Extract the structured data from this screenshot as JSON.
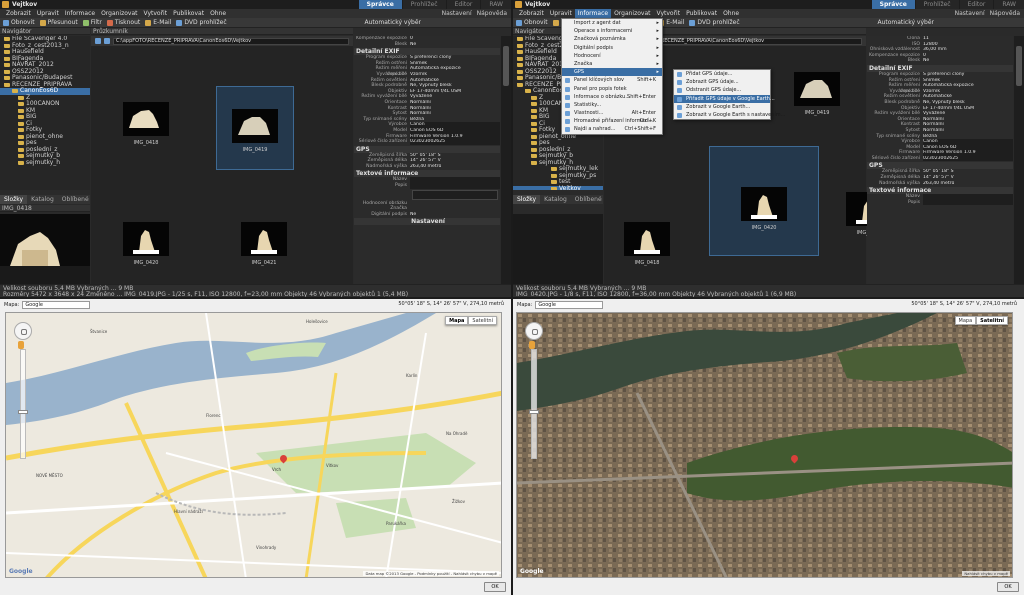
{
  "app": {
    "title": "Vejtkov",
    "modes": [
      "Správce",
      "Prohlížeč",
      "Editor",
      "RAW"
    ],
    "menu": [
      "Zobrazit",
      "Upravit",
      "Informace",
      "Organizovat",
      "Vytvořit",
      "Publikovat",
      "Ohne"
    ],
    "menu_right": [
      "Nastavení",
      "Nápověda"
    ],
    "toolbar": [
      "Obnovit",
      "Přesunout",
      "Filtr",
      "Tisknout",
      "E-Mail",
      "DVD prohlížeč"
    ],
    "toolbar_right": "Automatický výběr"
  },
  "left": {
    "panel_head_tree": "Navigátor",
    "panel_head_browser": "Průzkumník",
    "path": "C:\\appFOTO\\RECENZE_PRIPRAVA\\CanonEos6D\\Vejtkov",
    "tree": [
      "File Scavenger 4.0",
      "Foto_z_cest2013_n",
      "Hausefield",
      "BIFagenda",
      "NÁVRAT_2012",
      "OSSZ2012",
      "Panasonic/Budapest",
      "RECENZE_PRIPRAVA",
      "CanonEos6D",
      "Z",
      "100CANON",
      "KM",
      "BIG",
      "Ci",
      "Fotky",
      "pienot_ohne",
      "pes",
      "poslední_z",
      "sejmutky_b",
      "sejmutky_h"
    ],
    "selected_tree": 8,
    "tabs": [
      "Složky",
      "Katalog",
      "Oblíbené"
    ],
    "preview_head": "IMG_0418",
    "thumbs": [
      "IMG_0418",
      "IMG_0419",
      "IMG_0420",
      "IMG_0421"
    ],
    "status_line1": "Velikost souboru 5,4 MB   Vybraných ... 9 MB",
    "status_line2": "Rozměry 5472 x 3648 x 24   Změněno ...   IMG_0419.JPG - 1/25 s, F11, ISO 12800, f=23,00 mm   Objekty 46   Vybraných objektů 1 (5,4 MB)"
  },
  "info": {
    "rows_top": [
      [
        "Kompenzace expozice",
        "0"
      ],
      [
        "Blesk",
        "Ne"
      ]
    ],
    "exif_title": "Detailní EXIF",
    "exif": [
      [
        "Program expozice",
        "S preferencí clony"
      ],
      [
        "Režim ostření",
        "Snímek"
      ],
      [
        "Režim měření expozice",
        "Automatická expozice"
      ],
      [
        "Vyvážení bílé",
        "Vzorník"
      ],
      [
        "Režim osvětlení",
        "Automatické"
      ],
      [
        "Blesk podrobně",
        "Ne, Vypnutý blesk"
      ],
      [
        "Objektiv",
        "EF 17-40mm f/4L USM"
      ],
      [
        "Režim vyvážení bílé",
        "Vyvážené"
      ],
      [
        "Orientace",
        "Normální"
      ],
      [
        "Kontrast",
        "Normální"
      ],
      [
        "Sytost",
        "Normální"
      ],
      [
        "Typ snímané scény",
        "Běžná"
      ],
      [
        "Výrobce",
        "Canon"
      ],
      [
        "Model",
        "Canon EOS 6D"
      ],
      [
        "Firmware",
        "Firmware Version 1.0.9"
      ],
      [
        "Sériové číslo zařízení",
        "023023002625"
      ]
    ],
    "gps_title": "GPS",
    "gps": [
      [
        "Zeměpisná šířka",
        "50° 05' 18\" S"
      ],
      [
        "Zeměpisná délka",
        "14° 26' 57\" V"
      ],
      [
        "Nadmořská výška",
        "263,40 metrů"
      ]
    ],
    "text_title": "Textové informace",
    "text": [
      [
        "Název",
        ""
      ],
      [
        "Popis",
        ""
      ]
    ],
    "rating_label": "Hodnocení obrázku",
    "color_label": "Značka",
    "signature_label": "Digitální podpis",
    "signature_value": "Ne",
    "footer": "Nastavení"
  },
  "right_info": {
    "rows": [
      [
        "Clona",
        "11"
      ],
      [
        "ISO",
        "12800"
      ],
      [
        "Ohnisková vzdálenost",
        "36,00 mm"
      ],
      [
        "Kompenzace expozice",
        "0"
      ],
      [
        "Blesk",
        "Ne"
      ]
    ]
  },
  "info_menu": [
    {
      "label": "Import z agent dat",
      "sc": "",
      "arrow": true
    },
    {
      "label": "Operace s informacemi",
      "sc": "",
      "arrow": true
    },
    {
      "label": "Značková poznámka",
      "sc": "",
      "arrow": true
    },
    {
      "label": "Digitální podpis",
      "sc": "",
      "arrow": true
    },
    {
      "label": "Hodnocení",
      "sc": "",
      "arrow": true
    },
    {
      "label": "Značka",
      "sc": "",
      "arrow": true
    },
    {
      "label": "GPS",
      "sc": "",
      "arrow": true
    },
    {
      "label": "Panel klíčových slov",
      "sc": "Shift+K",
      "arrow": false
    },
    {
      "label": "Panel pro popis fotek",
      "sc": "",
      "arrow": false
    },
    {
      "label": "Informace o obrázku...",
      "sc": "Shift+Enter",
      "arrow": false
    },
    {
      "label": "Statistiky...",
      "sc": "",
      "arrow": false
    },
    {
      "label": "Vlastnosti...",
      "sc": "Alt+Enter",
      "arrow": false
    },
    {
      "label": "Hromadné přiřazení informací...",
      "sc": "Ctrl+K",
      "arrow": false
    },
    {
      "label": "Najdi a nahrad...",
      "sc": "Ctrl+Shift+F",
      "arrow": false
    }
  ],
  "gps_menu": [
    {
      "label": "Přidat GPS údaje..."
    },
    {
      "label": "Zobrazit GPS údaje..."
    },
    {
      "label": "Odstranit GPS údaje..."
    },
    {
      "label": "Přiřadit GPS údaje v Google Earth..."
    },
    {
      "label": "Zobrazit v Google Earth..."
    },
    {
      "label": "Zobrazit v Google Earth s nastavením..."
    }
  ],
  "right": {
    "tree": [
      "sejmutky_lek",
      "sejmutky_ps",
      "test",
      "Vejtkov"
    ],
    "thumbs": [
      "IMG_0418",
      "IMG_0419",
      "IMG_0420",
      "IMG_0421"
    ],
    "status": "IMG_0420.JPG - 1/8 s, F11, ISO 12800, f=36,00 mm   Objekty 46   Vybraných objektů 1 (6,9 MB)"
  },
  "map": {
    "label": "Mapa:",
    "provider": "Google",
    "coords": "50°05' 18\" S, 14° 26' 57\" V, 274,10 metrů",
    "types": [
      "Mapa",
      "Satelitní"
    ],
    "copyright": "Data map ©2013 Google - Podmínky použití - Nahlásit chybu v mapě",
    "copyright_sat": "Nahlásit chybu v mapě",
    "ok": "OK",
    "logo": "Google",
    "pin_label": "Vrch",
    "places": [
      "Štvanice",
      "Holešovice",
      "Florenc",
      "Vítkov",
      "Parukářka",
      "Karlín",
      "Na Ohradě",
      "Žižkov",
      "Hlavní nádraží",
      "Vinohrady",
      "NOVÉ MĚSTO"
    ]
  }
}
